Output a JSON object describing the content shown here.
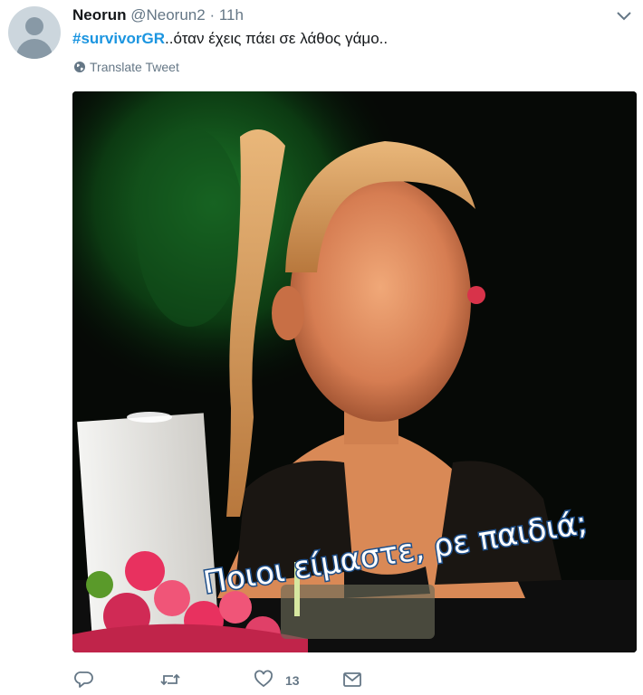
{
  "author": {
    "name": "Neorun",
    "handle": "@Neorun2",
    "separator": "·",
    "time": "11h"
  },
  "tweet": {
    "hashtag": "#survivorGR",
    "text": "..όταν έχεις πάει σε λάθος γάμο.."
  },
  "translate_label": "Translate Tweet",
  "media": {
    "subtitle": "Ποιοι είμαστε, ρε παιδιά;"
  },
  "actions": {
    "reply_icon": "reply-icon",
    "retweet_icon": "retweet-icon",
    "like_icon": "heart-icon",
    "like_count": "13",
    "dm_icon": "envelope-icon"
  },
  "colors": {
    "link": "#1b95e0",
    "muted": "#657786",
    "text": "#14171a"
  }
}
